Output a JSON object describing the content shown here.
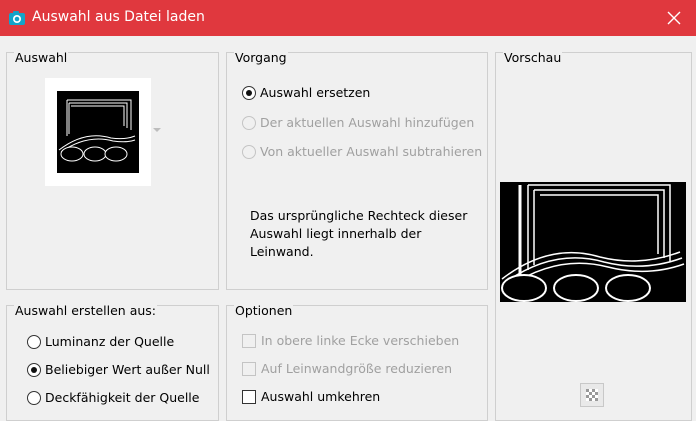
{
  "window": {
    "title": "Auswahl aus Datei laden"
  },
  "auswahl": {
    "label": "Auswahl"
  },
  "vorgang": {
    "label": "Vorgang",
    "options": [
      {
        "label": "Auswahl ersetzen",
        "checked": true,
        "enabled": true
      },
      {
        "label": "Der aktuellen Auswahl hinzufügen",
        "checked": false,
        "enabled": false
      },
      {
        "label": "Von aktueller Auswahl subtrahieren",
        "checked": false,
        "enabled": false
      }
    ],
    "info": "Das ursprüngliche Rechteck dieser Auswahl liegt innerhalb der Leinwand."
  },
  "vorschau": {
    "label": "Vorschau"
  },
  "erstellen": {
    "label": "Auswahl erstellen aus:",
    "options": [
      {
        "label": "Luminanz der Quelle",
        "checked": false
      },
      {
        "label": "Beliebiger Wert außer Null",
        "checked": true
      },
      {
        "label": "Deckfähigkeit der Quelle",
        "checked": false
      }
    ]
  },
  "optionen": {
    "label": "Optionen",
    "items": [
      {
        "label": "In obere linke Ecke verschieben",
        "checked": false,
        "enabled": false
      },
      {
        "label": "Auf Leinwandgröße reduzieren",
        "checked": false,
        "enabled": false
      },
      {
        "label": "Auswahl umkehren",
        "checked": false,
        "enabled": true
      }
    ]
  },
  "colors": {
    "titlebar": "#e0383e",
    "icon_accent": "#13a3c9"
  }
}
